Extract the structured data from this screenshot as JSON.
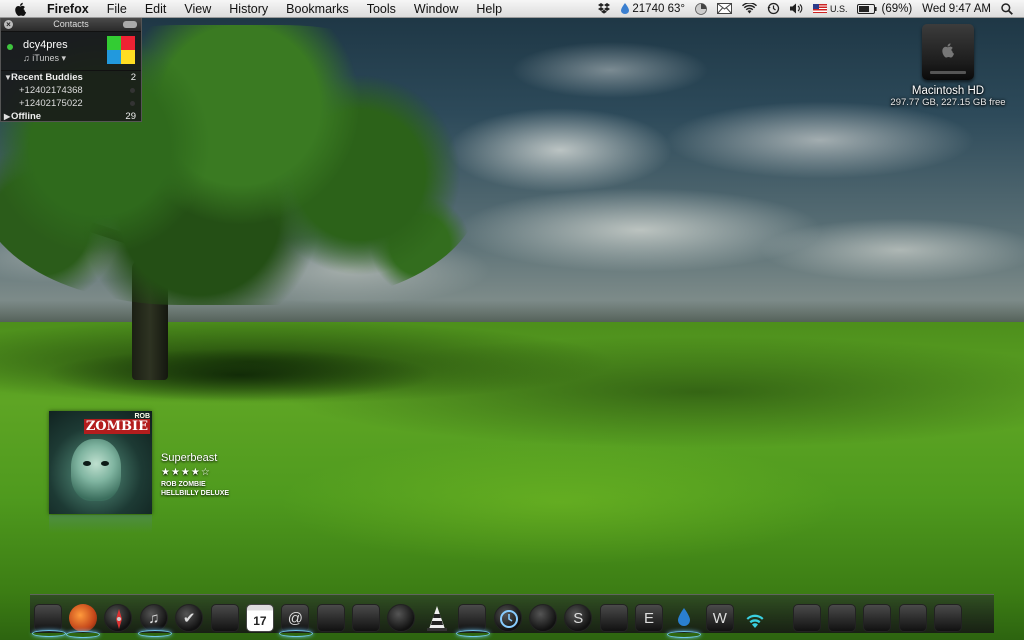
{
  "menubar": {
    "app_name": "Firefox",
    "menus": [
      "File",
      "Edit",
      "View",
      "History",
      "Bookmarks",
      "Tools",
      "Window",
      "Help"
    ],
    "status": {
      "weather": "21740 63°",
      "input_source": "U.S.",
      "battery": "(69%)",
      "clock": "Wed 9:47 AM"
    }
  },
  "contacts": {
    "title": "Contacts",
    "username": "dcy4pres",
    "status_text": "iTunes",
    "groups": [
      {
        "name": "Recent Buddies",
        "count": "2",
        "expanded": true,
        "buddies": [
          "+12402174368",
          "+12402175022"
        ]
      },
      {
        "name": "Offline",
        "count": "29",
        "expanded": false
      }
    ]
  },
  "desktop": {
    "drive_name": "Macintosh HD",
    "drive_info": "297.77 GB, 227.15 GB free"
  },
  "now_playing": {
    "track": "Superbeast",
    "stars": "★★★★☆",
    "rating": 4,
    "artist": "ROB ZOMBIE",
    "album": "HELLBILLY DELUXE",
    "cover_text_top": "ROB",
    "cover_text_main": "ZOMBIE"
  },
  "dock": {
    "calendar_day": "17",
    "icons": [
      "finder-icon",
      "firefox-icon",
      "safari-icon",
      "itunes-icon",
      "mail-icon",
      "preview-icon",
      "ical-icon",
      "address-book-icon",
      "photo-booth-icon",
      "iphoto-icon",
      "pen-tool-icon",
      "vlc-icon",
      "system-preferences-icon",
      "time-machine-icon",
      "alarm-clock-icon",
      "skype-icon",
      "transmission-icon",
      "text-edit-icon",
      "water-drop-icon",
      "wireless-icon",
      "wifi-icon",
      "downloads-stack-icon",
      "movies-stack-icon",
      "applications-stack-icon",
      "documents-stack-icon",
      "trash-icon"
    ]
  },
  "colors": {
    "menubar": "#e6e6e6",
    "dock_indicator": "#78d2ff",
    "grass": "#5ea524",
    "sky": "#2d4a5a"
  }
}
